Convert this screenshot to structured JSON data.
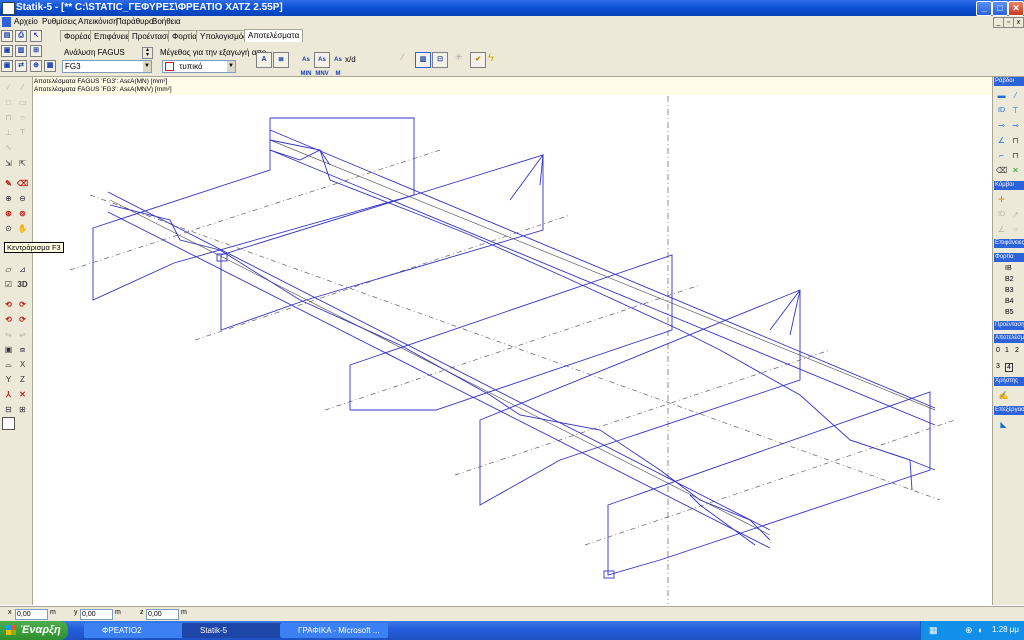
{
  "window": {
    "title": "Statik-5 - [** C:\\STATIC_ΓΕΦΥΡΕΣ\\ΦΡΕΑΤΙΟ ΧΑΤΖ 2.55P]"
  },
  "menu": [
    "Αρχείο",
    "Ρυθμίσεις",
    "Απεικόνιση",
    "Παράθυρο",
    "Βοήθεια"
  ],
  "tabs": [
    "Φορέας",
    "Επιφάνειες",
    "Προένταση",
    "Φορτία",
    "Υπολογισμός",
    "Αποτελέσματα"
  ],
  "active_tab": "Αποτελέσματα",
  "analysis": {
    "label": "Ανάλυση FAGUS",
    "value": "FG3"
  },
  "size_export": {
    "label": "Μέγεθος για την εξαγωγή απο",
    "value": "τυπικό"
  },
  "result_buttons": [
    "As MIN",
    "As MNV",
    "As M",
    "x/d"
  ],
  "info_lines": [
    "Αποτελέσματα FAGUS 'FG3':  AsεΑ(MN) [mm²]",
    "Αποτελέσματα FAGUS 'FG3':  AsεΑ(MNV) [mm²]"
  ],
  "tooltip": "Κεντράρισμα F3",
  "left_tool_3d": "3D",
  "left_tool_labels": {
    "x": "X",
    "y": "Y",
    "z": "Z",
    "t": "T"
  },
  "right_panel": {
    "sections": [
      "Ράβδοι",
      "Κόμβοι",
      "Επιφάνειες",
      "Φορτία",
      "Προένταση",
      "Αποτελέσμ.",
      "Χρήστης",
      "Επεξεργασία"
    ],
    "loads": [
      "IB",
      "B2",
      "B3",
      "B4",
      "B5"
    ],
    "result_numbers": [
      "0",
      "1",
      "2",
      "3",
      "4"
    ]
  },
  "coords": {
    "x_label": "x",
    "x": "0,00",
    "y_label": "y",
    "y": "0,00",
    "z_label": "z",
    "z": "0,00",
    "unit": "m"
  },
  "taskbar": {
    "start": "Έναρξη",
    "tasks": [
      "ΦΡΕΑΤΙΟ2",
      "Statik-5",
      "ΓΡΑΦΙΚΑ - Microsoft ..."
    ],
    "active_task": "Statik-5",
    "clock": "1:28 μμ"
  },
  "colors": {
    "structure": "#3232c8",
    "axis": "#606060",
    "tooltip_bg": "#ffffe1"
  }
}
